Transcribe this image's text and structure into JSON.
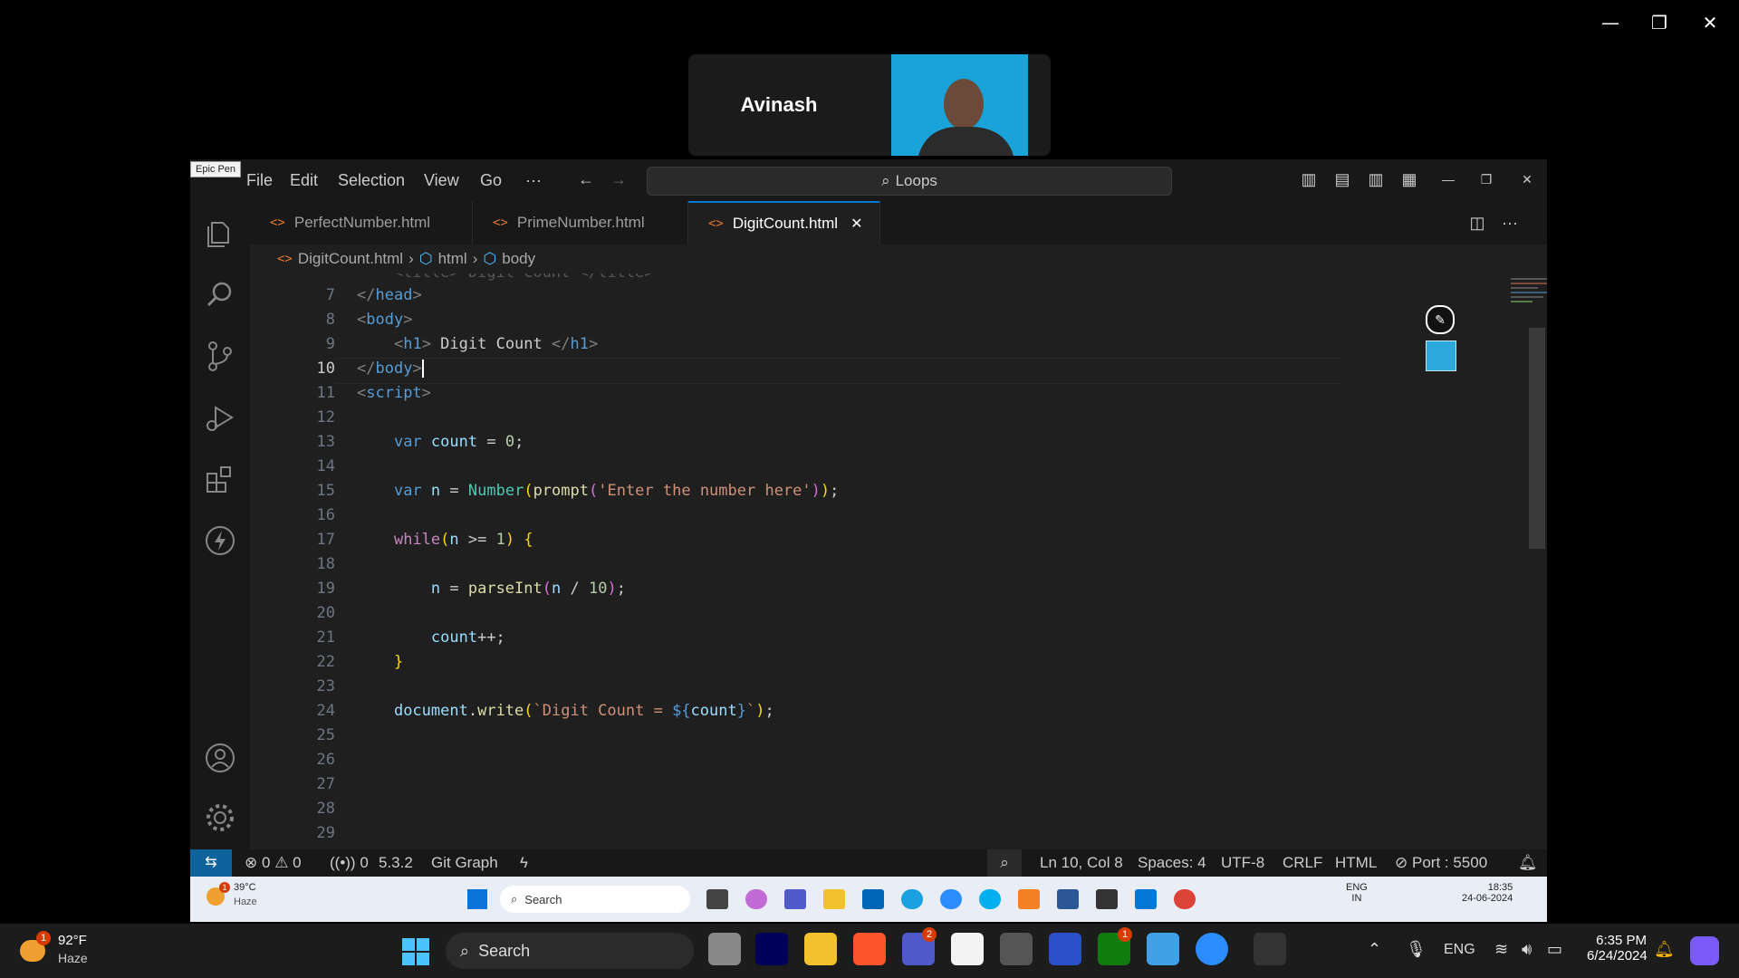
{
  "meeting": {
    "participant_name": "Avinash"
  },
  "window_controls": {
    "minimize": "—",
    "restore": "❐",
    "close": "✕"
  },
  "tooltip": "Epic Pen",
  "menu": [
    "File",
    "Edit",
    "Selection",
    "View",
    "Go",
    "···"
  ],
  "search": {
    "value": "Loops"
  },
  "tabs": [
    {
      "label": "PerfectNumber.html",
      "active": false
    },
    {
      "label": "PrimeNumber.html",
      "active": false
    },
    {
      "label": "DigitCount.html",
      "active": true
    }
  ],
  "breadcrumb": {
    "file": "DigitCount.html",
    "items": [
      "html",
      "body"
    ]
  },
  "line_numbers": [
    "7",
    "8",
    "9",
    "10",
    "11",
    "12",
    "13",
    "14",
    "15",
    "16",
    "17",
    "18",
    "19",
    "20",
    "21",
    "22",
    "23",
    "24",
    "25",
    "26",
    "27",
    "28",
    "29"
  ],
  "current_line": "10",
  "status": {
    "errors": "0",
    "warnings": "0",
    "ports": "0",
    "version": "5.3.2",
    "git_graph": "Git Graph",
    "position": "Ln 10, Col 8",
    "spaces": "Spaces: 4",
    "encoding": "UTF-8",
    "eol": "CRLF",
    "language": "HTML",
    "port": "Port : 5500"
  },
  "inner_taskbar": {
    "temp": "39°C",
    "weather": "Haze",
    "search": "Search",
    "lang1": "ENG",
    "lang2": "IN",
    "time": "18:35",
    "date": "24-06-2024",
    "weather_badge": "1"
  },
  "taskbar": {
    "temp": "92°F",
    "weather": "Haze",
    "search": "Search",
    "lang": "ENG",
    "time": "6:35 PM",
    "date": "6/24/2024",
    "weather_badge": "1",
    "teams_badge": "2",
    "xbox_badge": "1"
  },
  "colors": {
    "accent": "#0078d4",
    "remote": "#0e639c",
    "bg": "#1f1f1f"
  }
}
